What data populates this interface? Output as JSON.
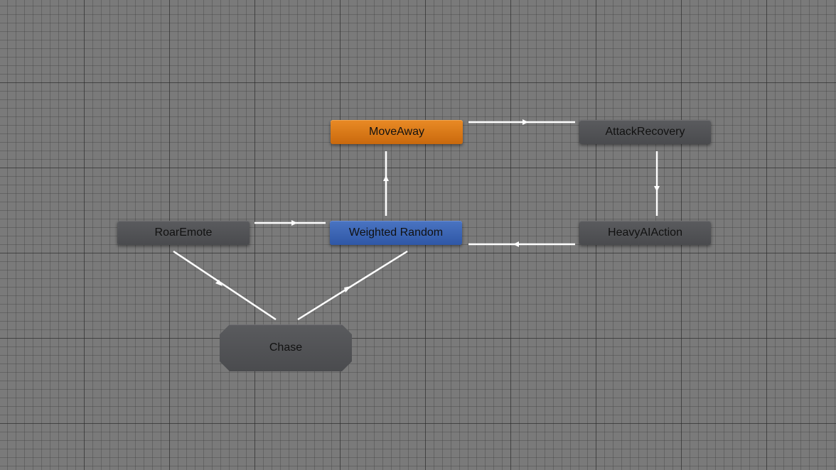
{
  "graph": {
    "nodes": {
      "move_away": {
        "label": "MoveAway",
        "color": "#d67a18"
      },
      "attack_recovery": {
        "label": "AttackRecovery",
        "color": "#545558"
      },
      "roar_emote": {
        "label": "RoarEmote",
        "color": "#545558"
      },
      "weighted_random": {
        "label": "Weighted Random",
        "color": "#3b63b4"
      },
      "heavy_ai_action": {
        "label": "HeavyAIAction",
        "color": "#545558"
      },
      "chase": {
        "label": "Chase",
        "color": "#545558",
        "kind": "sub-state-machine"
      }
    },
    "transitions": [
      {
        "from": "move_away",
        "to": "attack_recovery"
      },
      {
        "from": "attack_recovery",
        "to": "heavy_ai_action"
      },
      {
        "from": "heavy_ai_action",
        "to": "weighted_random"
      },
      {
        "from": "weighted_random",
        "to": "move_away"
      },
      {
        "from": "roar_emote",
        "to": "weighted_random"
      },
      {
        "from": "roar_emote",
        "to": "chase"
      },
      {
        "from": "chase",
        "to": "weighted_random"
      }
    ],
    "background_color": "#7a7a7a",
    "link_color": "#ffffff"
  }
}
